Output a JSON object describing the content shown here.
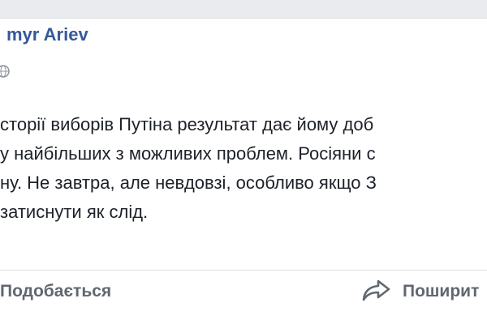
{
  "post": {
    "author": "myr Ariev",
    "lines": [
      "сторії виборів Путіна результат дає йому доб",
      "у найбільших з можливих проблем. Росіяни с",
      "ну. Не завтра, але невдовзі, особливо якщо З",
      " затиснути як слід."
    ]
  },
  "actions": {
    "like_label": "Подобається",
    "share_label": "Поширит"
  },
  "icons": {
    "privacy": "globe-icon",
    "share": "share-arrow-icon"
  },
  "colors": {
    "author": "#365899",
    "text": "#1d2129",
    "action": "#606770",
    "background": "#e9ebee"
  }
}
